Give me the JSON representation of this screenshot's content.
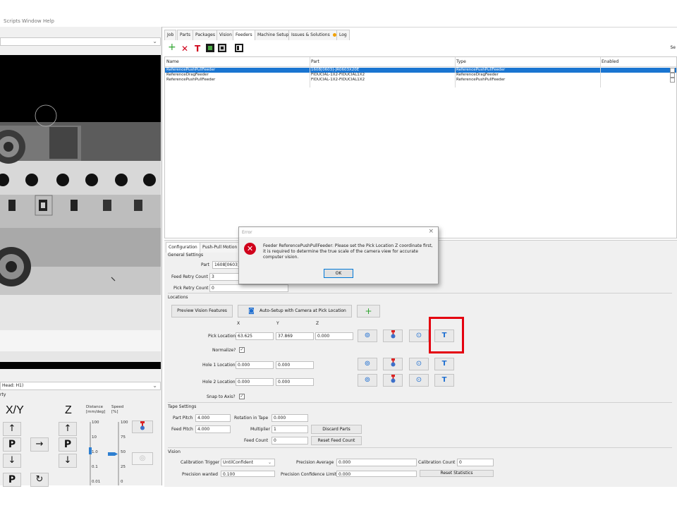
{
  "menubar": {
    "items": [
      "Scripts",
      "Window",
      "Help"
    ]
  },
  "left": {
    "head_combo": "Head: H1)",
    "sub_label": "rty",
    "jog": {
      "xy_label": "X/Y",
      "z_label": "Z",
      "distance_label": "Distance\n[mm/deg]",
      "speed_label": "Speed\n[%]",
      "distance_values": [
        "100",
        "10",
        "1.0",
        "0.1",
        "0.01"
      ],
      "speed_values": [
        "100",
        "75",
        "50",
        "25",
        "0"
      ],
      "up": "↑",
      "down": "↓",
      "right": "→",
      "park": "P",
      "rotate": "↻"
    }
  },
  "tabs_top": [
    "Job",
    "Parts",
    "Packages",
    "Vision",
    "Feeders",
    "Machine Setup",
    "Issues & Solutions",
    "Log"
  ],
  "toolbar_right_text": "Se",
  "table": {
    "columns": [
      "Name",
      "Part",
      "Type",
      "Enabled"
    ],
    "rows": [
      {
        "name": "ReferencePushPullFeeder",
        "part": "1608[0603]-JR0603X20E",
        "type": "ReferencePushPullFeeder",
        "selected": true
      },
      {
        "name": "ReferenceDragFeeder",
        "part": "FIDUCIAL-1X2-FIDUCIAL1X2",
        "type": "ReferenceDragFeeder",
        "selected": false
      },
      {
        "name": "ReferencePushPullFeeder",
        "part": "FIDUCIAL-1X2-FIDUCIAL1X2",
        "type": "ReferencePushPullFeeder",
        "selected": false
      }
    ]
  },
  "config": {
    "tabs": [
      "Configuration",
      "Push-Pull Motion"
    ],
    "general_settings": "General Settings",
    "part_label": "Part",
    "part_value": "1608[0603]-",
    "feed_retry_label": "Feed Retry Count",
    "feed_retry_value": "3",
    "pick_retry_label": "Pick Retry Count",
    "pick_retry_value": "0",
    "locations_title": "Locations",
    "preview_btn": "Preview Vision Features",
    "autosetup_btn": "Auto-Setup with Camera at Pick Location",
    "col_x": "X",
    "col_y": "Y",
    "col_z": "Z",
    "pick_label": "Pick Location",
    "pick_x": "63.625",
    "pick_y": "37.869",
    "pick_z": "0.000",
    "normalize_label": "Normalize?",
    "hole1_label": "Hole 1 Location",
    "hole1_x": "0.000",
    "hole1_y": "0.000",
    "hole2_label": "Hole 2 Location",
    "hole2_x": "0.000",
    "hole2_y": "0.000",
    "snap_label": "Snap to Axis?",
    "tape_title": "Tape Settings",
    "part_pitch_label": "Part Pitch",
    "part_pitch_value": "4.000",
    "rotation_label": "Rotation in Tape",
    "rotation_value": "0.000",
    "feed_pitch_label": "Feed Pitch",
    "feed_pitch_value": "4.000",
    "multiplier_label": "Multiplier",
    "multiplier_value": "1",
    "discard_btn": "Discard Parts",
    "feed_count_label": "Feed Count",
    "feed_count_value": "0",
    "reset_feed_btn": "Reset Feed Count",
    "vision_title": "Vision",
    "calib_trigger_label": "Calibration Trigger",
    "calib_trigger_value": "UntilConfident",
    "precision_avg_label": "Precision Average",
    "precision_avg_value": "0.000",
    "calib_count_label": "Calibration Count",
    "calib_count_value": "0",
    "precision_wanted_label": "Precision wanted",
    "precision_wanted_value": "0.100",
    "precision_conf_label": "Precision Confidence Limit",
    "precision_conf_value": "0.000",
    "reset_stats_btn": "Reset Statistics"
  },
  "dialog": {
    "title": "Error",
    "message": "Feeder ReferencePushPullFeeder: Please set the Pick Location Z coordinate first, it is required to determine the true scale of the camera view for accurate computer vision.",
    "ok": "OK"
  },
  "colors": {
    "selection": "#1a75d1",
    "highlight_red": "#e4000f",
    "error_red": "#d0021b"
  }
}
